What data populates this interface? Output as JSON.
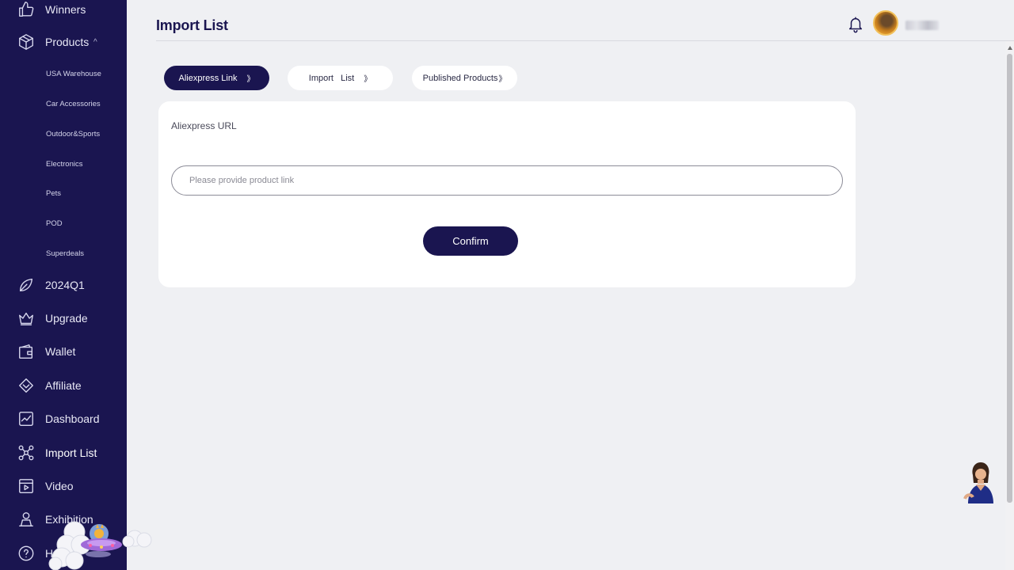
{
  "sidebar": {
    "items": [
      {
        "label": "Winners",
        "icon": "thumbs-up-icon"
      },
      {
        "label": "Products",
        "icon": "box-icon",
        "chevron": "^"
      },
      {
        "label": "2024Q1",
        "icon": "leaf-icon"
      },
      {
        "label": "Upgrade",
        "icon": "crown-icon"
      },
      {
        "label": "Wallet",
        "icon": "wallet-icon"
      },
      {
        "label": "Affiliate",
        "icon": "diamond-icon"
      },
      {
        "label": "Dashboard",
        "icon": "chart-icon"
      },
      {
        "label": "Import List",
        "icon": "network-icon",
        "active": true
      },
      {
        "label": "Video",
        "icon": "video-icon"
      },
      {
        "label": "Exhibition",
        "icon": "exhibition-icon"
      },
      {
        "label": "H",
        "icon": "help-icon"
      }
    ],
    "product_subitems": [
      "USA Warehouse",
      "Car Accessories",
      "Outdoor&Sports",
      "Electronics",
      "Pets",
      "POD",
      "Superdeals"
    ]
  },
  "header": {
    "title": "Import List",
    "icons": [
      "bell-icon",
      "avatar"
    ]
  },
  "tabs": [
    {
      "label": "Aliexpress Link",
      "arrow": "》",
      "active": true
    },
    {
      "label": "Import   List",
      "arrow": "》",
      "active": false
    },
    {
      "label": "Published Products",
      "arrow": "》",
      "active": false
    }
  ],
  "form": {
    "label": "Aliexpress URL",
    "input_value": "",
    "input_placeholder": "Please provide product link",
    "confirm_label": "Confirm"
  },
  "colors": {
    "sidebar_bg": "#1a1550",
    "accent": "#1a1550",
    "page_bg": "#eff0f3",
    "card_bg": "#ffffff"
  }
}
